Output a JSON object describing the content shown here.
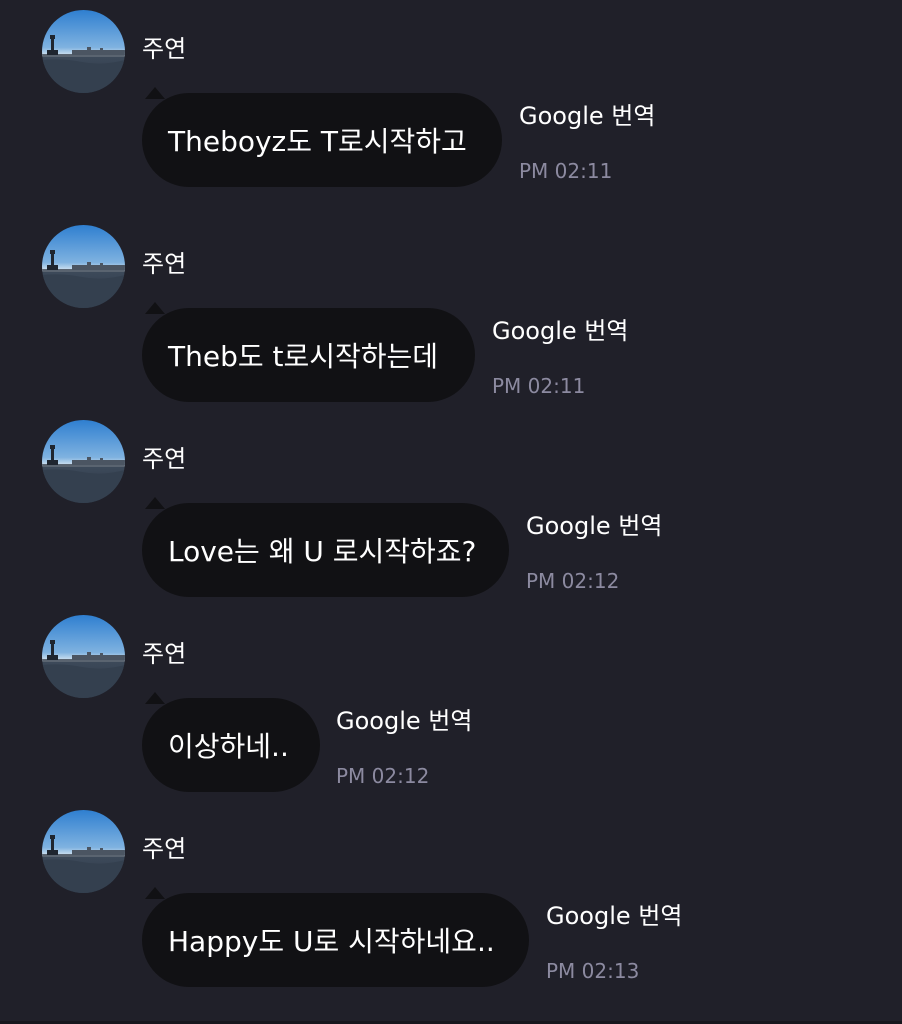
{
  "messages": [
    {
      "sender": "주연",
      "text": "Theboyz도 T로시작하고",
      "translate_label": "Google 번역",
      "time": "PM 02:11"
    },
    {
      "sender": "주연",
      "text": "Theb도 t로시작하는데",
      "translate_label": "Google 번역",
      "time": "PM 02:11"
    },
    {
      "sender": "주연",
      "text": "Love는 왜 U 로시작하죠?",
      "translate_label": "Google 번역",
      "time": "PM 02:12"
    },
    {
      "sender": "주연",
      "text": "이상하네..",
      "translate_label": "Google 번역",
      "time": "PM 02:12"
    },
    {
      "sender": "주연",
      "text": "Happy도 U로 시작하네요..",
      "translate_label": "Google 번역",
      "time": "PM 02:13"
    }
  ],
  "colors": {
    "background": "#202029",
    "bubble": "#111114",
    "text": "#ffffff",
    "timestamp": "#8c8aa0"
  }
}
